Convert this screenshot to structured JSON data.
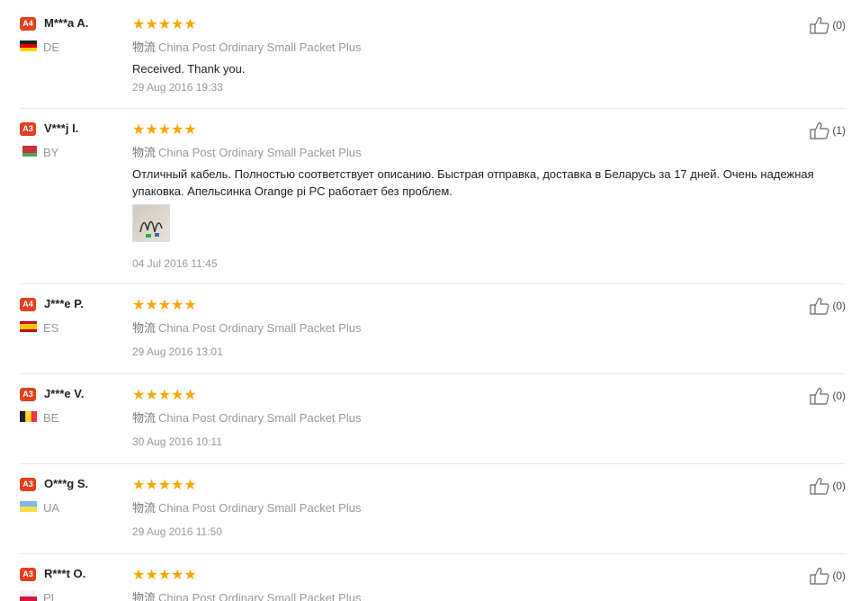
{
  "reviews": [
    {
      "badge": "A4",
      "name": "M***a A.",
      "country": "DE",
      "flag": "de",
      "stars": "★★★★★",
      "shipping_cn": "物流",
      "shipping": "China Post Ordinary Small Packet Plus",
      "comment": "Received. Thank you.",
      "date": "29 Aug 2016 19:33",
      "likes": "(0)"
    },
    {
      "badge": "A3",
      "name": "V***j I.",
      "country": "BY",
      "flag": "by",
      "stars": "★★★★★",
      "shipping_cn": "物流",
      "shipping": "China Post Ordinary Small Packet Plus",
      "comment": "Отличный кабель. Полностью соответствует описанию. Быстрая отправка, доставка в Беларусь за 17 дней. Очень надежная упаковка. Апельсинка Orange pi PC работает без проблем.",
      "date": "04 Jul 2016 11:45",
      "likes": "(1)"
    },
    {
      "badge": "A4",
      "name": "J***e P.",
      "country": "ES",
      "flag": "es",
      "stars": "★★★★★",
      "shipping_cn": "物流",
      "shipping": "China Post Ordinary Small Packet Plus",
      "comment": "",
      "date": "29 Aug 2016 13:01",
      "likes": "(0)"
    },
    {
      "badge": "A3",
      "name": "J***e V.",
      "country": "BE",
      "flag": "be",
      "stars": "★★★★★",
      "shipping_cn": "物流",
      "shipping": "China Post Ordinary Small Packet Plus",
      "comment": "",
      "date": "30 Aug 2016 10:11",
      "likes": "(0)"
    },
    {
      "badge": "A3",
      "name": "O***g S.",
      "country": "UA",
      "flag": "ua",
      "stars": "★★★★★",
      "shipping_cn": "物流",
      "shipping": "China Post Ordinary Small Packet Plus",
      "comment": "",
      "date": "29 Aug 2016 11:50",
      "likes": "(0)"
    },
    {
      "badge": "A3",
      "name": "R***t O.",
      "country": "PL",
      "flag": "pl",
      "stars": "★★★★★",
      "shipping_cn": "物流",
      "shipping": "China Post Ordinary Small Packet Plus",
      "comment": "",
      "date": "",
      "likes": "(0)"
    }
  ]
}
